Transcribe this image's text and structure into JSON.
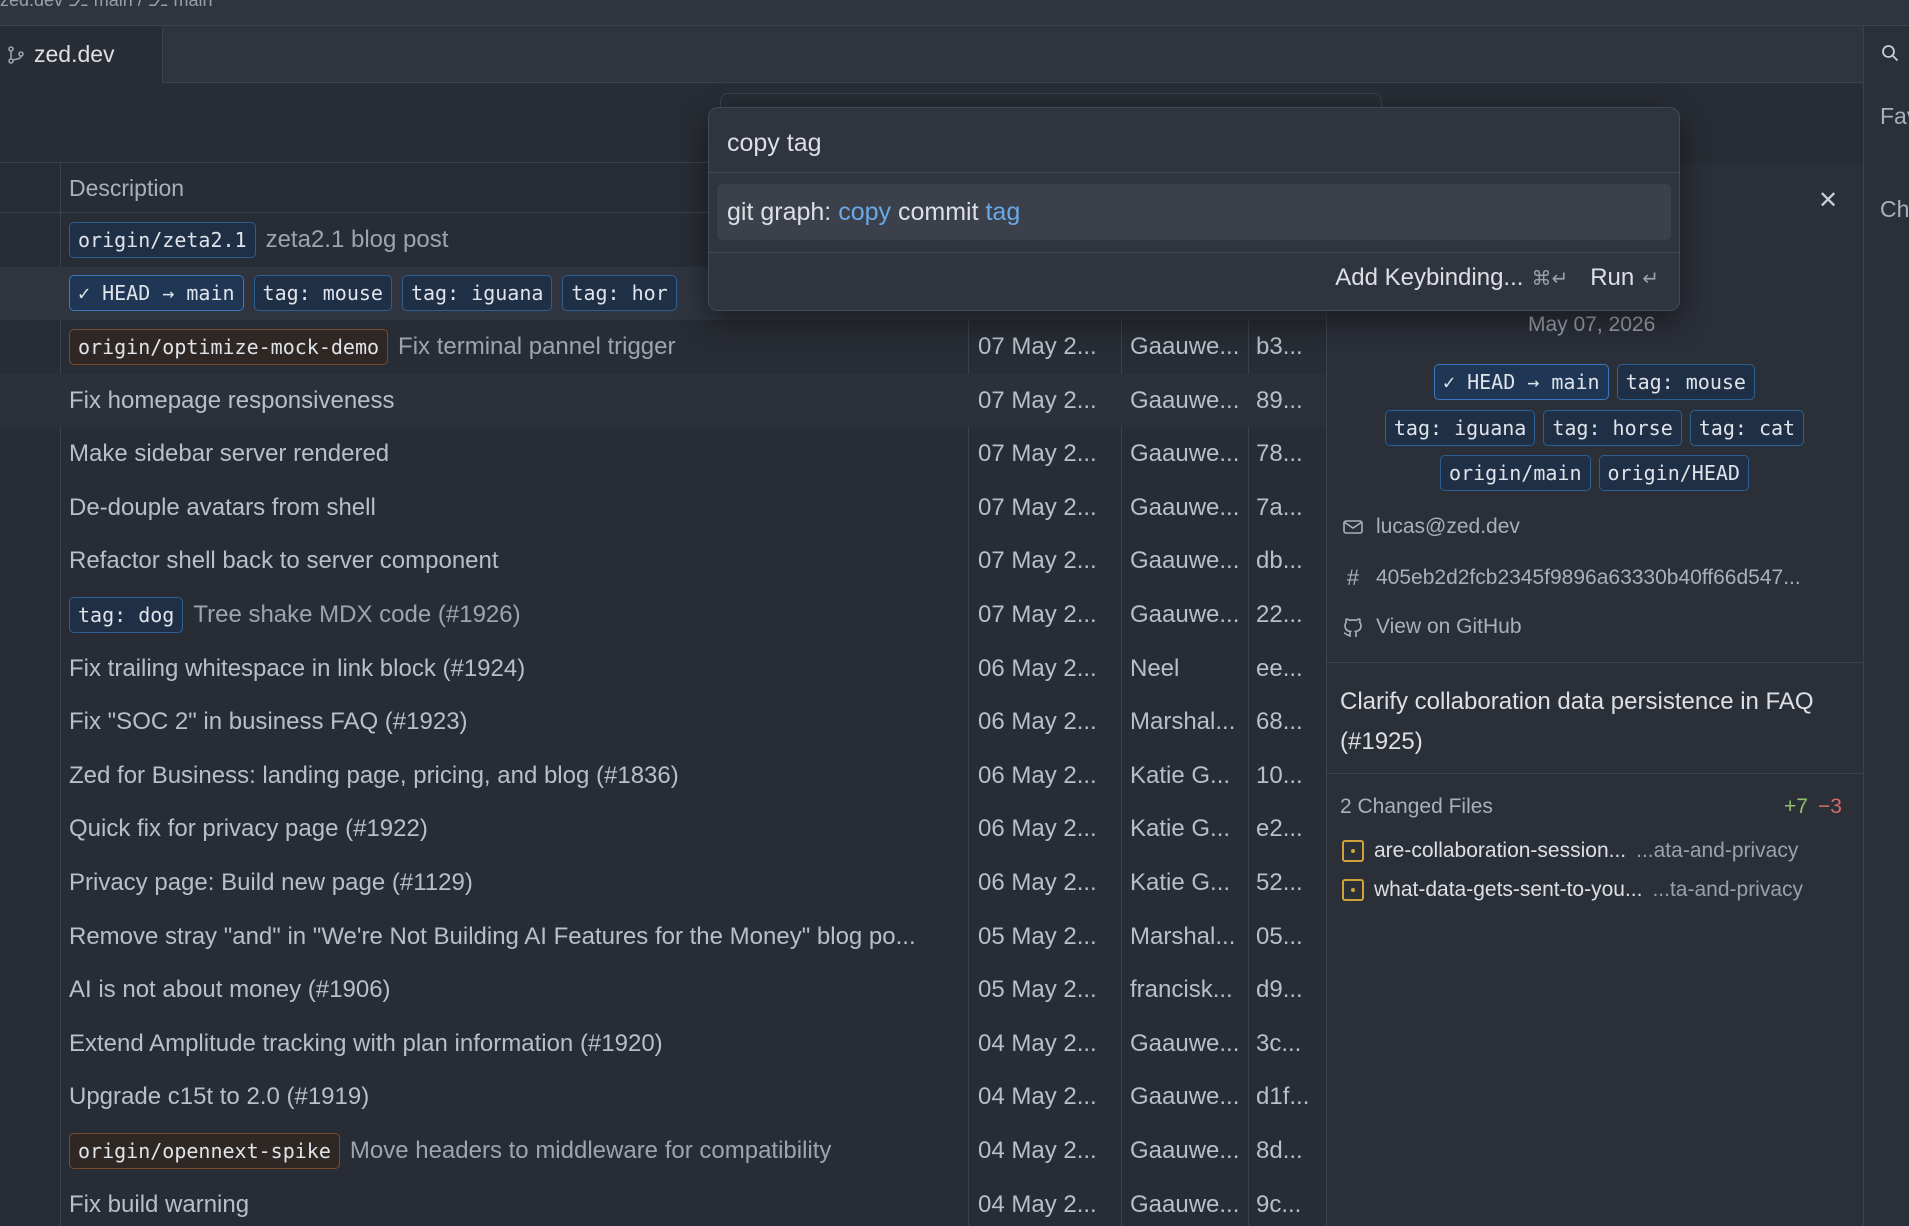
{
  "titlebar": {
    "crumb": "zed.dev   ⎇ main  /  ⎇ main"
  },
  "tab": {
    "label": "zed.dev"
  },
  "table": {
    "header_description": "Description",
    "rows": [
      {
        "badges": [
          {
            "text": "origin/zeta2.1",
            "style": "blue"
          }
        ],
        "desc": "zeta2.1 blog post",
        "date": "",
        "author": "",
        "sha": ""
      },
      {
        "badges": [
          {
            "text": "✓ HEAD → main",
            "style": "head"
          },
          {
            "text": "tag: mouse",
            "style": "blue"
          },
          {
            "text": "tag: iguana",
            "style": "blue"
          },
          {
            "text": "tag: hor",
            "style": "blue"
          }
        ],
        "desc": "",
        "date": "",
        "author": "",
        "sha": ""
      },
      {
        "badges": [
          {
            "text": "origin/optimize-mock-demo",
            "style": "orange"
          }
        ],
        "desc": "Fix terminal pannel trigger",
        "date": "07 May 2...",
        "author": "Gaauwe...",
        "sha": "b3..."
      },
      {
        "badges": [],
        "desc": "Fix homepage responsiveness",
        "date": "07 May 2...",
        "author": "Gaauwe...",
        "sha": "89..."
      },
      {
        "badges": [],
        "desc": "Make sidebar server rendered",
        "date": "07 May 2...",
        "author": "Gaauwe...",
        "sha": "78..."
      },
      {
        "badges": [],
        "desc": "De-douple avatars from shell",
        "date": "07 May 2...",
        "author": "Gaauwe...",
        "sha": "7a..."
      },
      {
        "badges": [],
        "desc": "Refactor shell back to server component",
        "date": "07 May 2...",
        "author": "Gaauwe...",
        "sha": "db..."
      },
      {
        "badges": [
          {
            "text": "tag: dog",
            "style": "blue"
          }
        ],
        "desc": "Tree shake MDX code (#1926)",
        "date": "07 May 2...",
        "author": "Gaauwe...",
        "sha": "22..."
      },
      {
        "badges": [],
        "desc": "Fix trailing whitespace in link block (#1924)",
        "date": "06 May 2...",
        "author": "Neel",
        "sha": "ee..."
      },
      {
        "badges": [],
        "desc": "Fix \"SOC 2\" in business FAQ (#1923)",
        "date": "06 May 2...",
        "author": "Marshal...",
        "sha": "68..."
      },
      {
        "badges": [],
        "desc": "Zed for Business: landing page, pricing, and blog (#1836)",
        "date": "06 May 2...",
        "author": "Katie G...",
        "sha": "10..."
      },
      {
        "badges": [],
        "desc": "Quick fix for privacy page (#1922)",
        "date": "06 May 2...",
        "author": "Katie G...",
        "sha": "e2..."
      },
      {
        "badges": [],
        "desc": "Privacy page: Build new page (#1129)",
        "date": "06 May 2...",
        "author": "Katie G...",
        "sha": "52..."
      },
      {
        "badges": [],
        "desc": "Remove stray \"and\" in \"We're Not Building AI Features for the Money\" blog po...",
        "date": "05 May 2...",
        "author": "Marshal...",
        "sha": "05..."
      },
      {
        "badges": [],
        "desc": "AI is not about money (#1906)",
        "date": "05 May 2...",
        "author": "francisk...",
        "sha": "d9..."
      },
      {
        "badges": [],
        "desc": "Extend Amplitude tracking with plan information (#1920)",
        "date": "04 May 2...",
        "author": "Gaauwe...",
        "sha": "3c..."
      },
      {
        "badges": [],
        "desc": "Upgrade c15t to 2.0 (#1919)",
        "date": "04 May 2...",
        "author": "Gaauwe...",
        "sha": "d1f..."
      },
      {
        "badges": [
          {
            "text": "origin/opennext-spike",
            "style": "orange"
          }
        ],
        "desc": "Move headers to middleware for compatibility",
        "date": "04 May 2...",
        "author": "Gaauwe...",
        "sha": "8d..."
      },
      {
        "badges": [],
        "desc": "Fix build warning",
        "date": "04 May 2...",
        "author": "Gaauwe...",
        "sha": "9c..."
      }
    ]
  },
  "detail": {
    "date": "May 07, 2026",
    "badge_rows": [
      [
        {
          "text": "✓ HEAD → main",
          "style": "head"
        },
        {
          "text": "tag: mouse",
          "style": "blue"
        }
      ],
      [
        {
          "text": "tag: iguana",
          "style": "blue"
        },
        {
          "text": "tag: horse",
          "style": "blue"
        },
        {
          "text": "tag: cat",
          "style": "blue"
        }
      ],
      [
        {
          "text": "origin/main",
          "style": "blue"
        },
        {
          "text": "origin/HEAD",
          "style": "blue"
        }
      ]
    ],
    "email": "lucas@zed.dev",
    "sha": "405eb2d2fcb2345f9896a63330b40ff66d547...",
    "github_link": "View on GitHub",
    "commit_title": "Clarify collaboration data persistence in FAQ (#1925)",
    "changed_files_label": "2 Changed Files",
    "added": "+7",
    "removed": "−3",
    "files": [
      {
        "name": "are-collaboration-session...",
        "path": "...ata-and-privacy"
      },
      {
        "name": "what-data-gets-sent-to-you...",
        "path": "...ta-and-privacy"
      }
    ]
  },
  "strip": {
    "item1": "Fav",
    "item2": "Ch"
  },
  "palette": {
    "query": "copy tag",
    "item_prefix": "git graph: ",
    "item_hl1": "copy",
    "item_mid": " commit ",
    "item_hl2": "tag",
    "add_keybinding": "Add Keybinding...",
    "add_keybinding_keys": "⌘↵",
    "run": "Run",
    "run_key": "↵"
  },
  "colors": {
    "background": "#282c34",
    "accent": "#6aa9e8",
    "added": "#8fbf6f",
    "removed": "#d46a6a"
  }
}
